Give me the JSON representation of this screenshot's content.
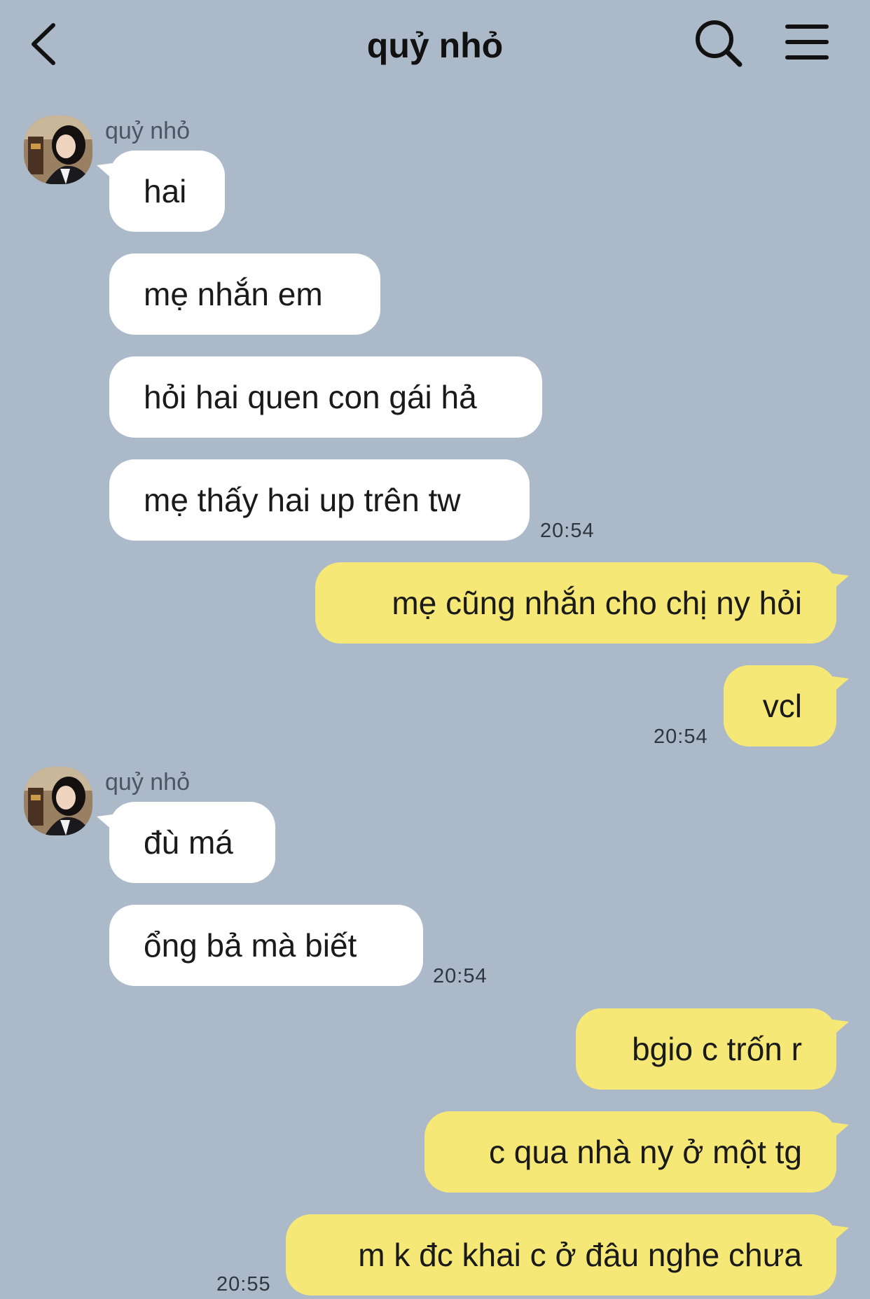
{
  "header": {
    "title": "quỷ nhỏ",
    "back_icon": "chevron-left-icon",
    "search_icon": "search-icon",
    "menu_icon": "hamburger-menu-icon"
  },
  "colors": {
    "background": "#abb9c9",
    "incoming_bubble": "#ffffff",
    "outgoing_bubble": "#f5e876"
  },
  "groups": [
    {
      "sender": "quỷ nhỏ",
      "direction": "in",
      "messages": [
        "hai",
        "mẹ nhắn em",
        "hỏi hai quen con gái hả",
        "mẹ thấy hai up trên tw"
      ],
      "time": "20:54"
    },
    {
      "direction": "out",
      "messages": [
        "mẹ cũng nhắn cho chị ny hỏi",
        "vcl"
      ],
      "time": "20:54"
    },
    {
      "sender": "quỷ nhỏ",
      "direction": "in",
      "messages": [
        "đù má",
        "ổng bả mà biết"
      ],
      "time": "20:54"
    },
    {
      "direction": "out",
      "messages": [
        "bgio c trốn r",
        "c qua nhà ny ở một tg",
        "m k đc khai c ở đâu nghe chưa"
      ],
      "time": "20:55"
    }
  ]
}
